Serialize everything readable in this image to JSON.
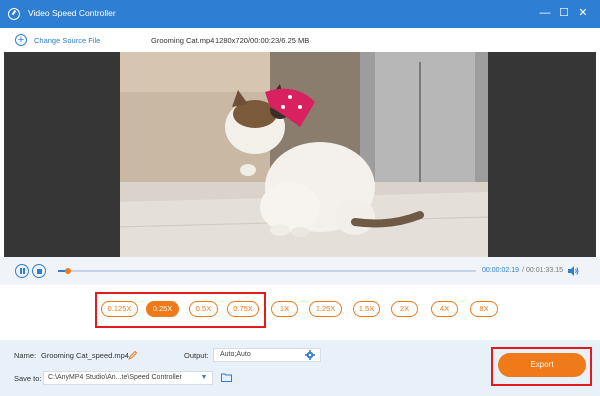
{
  "window": {
    "title": "Video Speed Controller",
    "icon": "speedometer-icon",
    "minimize_glyph": "—",
    "maximize_glyph": "☐",
    "close_glyph": "✕"
  },
  "file": {
    "change_source_label": "Change Source File",
    "name": "Grooming Cat.mp4",
    "info": "1280x720/00:00:23/6.25 MB"
  },
  "player": {
    "current_time": "00:00:02.19",
    "separator": "/",
    "total_time": "00:01:33.15",
    "progress": 0.024
  },
  "speed": {
    "options": [
      "0.125X",
      "0.25X",
      "0.5X",
      "0.75X",
      "1X",
      "1.25X",
      "1.5X",
      "2X",
      "4X",
      "8X"
    ],
    "selected": "0.25X"
  },
  "output": {
    "name_label": "Name:",
    "name_value": "Grooming Cat_speed.mp4",
    "output_label": "Output:",
    "output_value": "Auto;Auto",
    "save_label": "Save to:",
    "save_value": "C:\\AnyMP4 Studio\\An...te\\Speed Controller",
    "export_label": "Export"
  },
  "colors": {
    "title_bar": "#2e7fd3",
    "accent": "#f07a1a",
    "highlight": "#e21b1b"
  }
}
